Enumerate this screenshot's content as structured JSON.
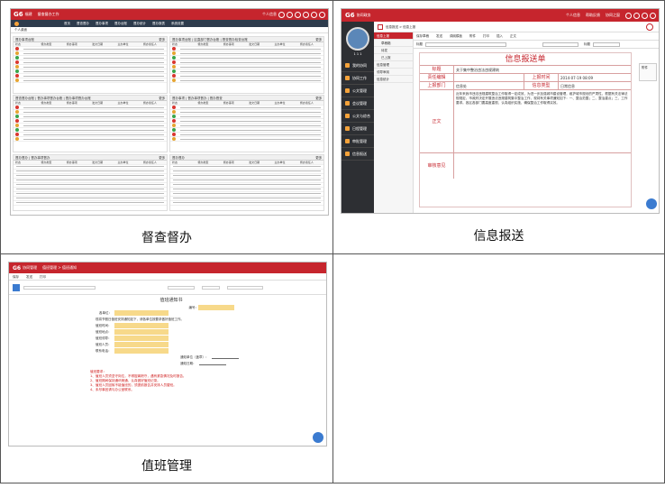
{
  "captions": {
    "supervision": "督查督办",
    "info_report": "信息报送",
    "duty": "值班管理"
  },
  "supervision_app": {
    "logo": "G6",
    "brand": "福建",
    "title": "督查督办工作",
    "user": "个人信息",
    "crumb": "个人桌面",
    "panels": [
      {
        "title": "督办事项台账",
        "more": "更多"
      },
      {
        "title": "督办事项台账 | 区直部门督办台账 | 督查督办检查台账",
        "more": "更多"
      },
      {
        "title": "督查督办台账 | 督办事项督办台账 | 督办事项督办台账",
        "more": "更多"
      },
      {
        "title": "督办事项 | 督办事项督办 | 督办督查",
        "more": "更多"
      },
      {
        "title": "督办督办 | 督办事项督办",
        "more": "更多"
      },
      {
        "title": "督办督办",
        "more": "更多"
      }
    ],
    "cols": [
      "状态",
      "督办类型",
      "督办事项",
      "发文日期",
      "主办单位",
      "督办责任人"
    ],
    "status_colors": [
      "#d9362f",
      "#e6a531",
      "#3aa54a"
    ]
  },
  "info_app": {
    "logo": "G6",
    "brand": "协同政务",
    "crumb": "信息报送 > 信息上报",
    "user_menu": [
      "个人信息",
      "帮助反馈",
      "协同之窗"
    ],
    "sidebar_user": "1 1 1",
    "sidebar": [
      "我的协同",
      "协同工作",
      "公文管理",
      "会议管理",
      "公文与综合",
      "日程管理",
      "审批管理",
      "信息报送"
    ],
    "tree": [
      "信息上报",
      "草稿箱",
      "待发",
      "已上报",
      "信息管理",
      "领导审阅",
      "信息统计"
    ],
    "toolbar": [
      "保存草稿",
      "发送",
      "调阅模板",
      "附件",
      "打印",
      "插入",
      "正文"
    ],
    "subject_label": "标题",
    "form_title": "信息报送单",
    "fields": {
      "title_label": "标题",
      "title_value": "关于集中整治违法违规建筑",
      "org_label": "责任编辑",
      "time_label": "上报时间",
      "time_value": "2014-07-19 08:09",
      "dept_label": "上报部门",
      "dept_value": "信息处",
      "type_label": "信息类型",
      "type_value": "日常信息",
      "body_label": "正文",
      "body_text": "近年来我市违法违规建筑整治工作取得一定成效，为进一步加强城市建设管理，维护城市规划的严肃性，根据有关法律法规规定，市政府决定开展违法违规建筑集中整治工作，现将有关事项通知如下：一、整治范围；二、整治重点；三、工作要求。各区各部门要高度重视，认真组织实施，确保整治工作取得实效。",
      "sign_label": "审核意见"
    },
    "right_labels": [
      "标题",
      "备注"
    ],
    "side_tab": "附件",
    "accent": "#c6252d"
  },
  "duty_app": {
    "logo": "G6",
    "brand": "协同管理",
    "crumb": "值班管理 > 值班通知",
    "toolbar": [
      "保存",
      "发送",
      "打印"
    ],
    "notice_title": "值班通知书",
    "doc_no_label": "编号：",
    "lines": [
      "各单位：",
      "现将节假日值班安排通知如下，请各单位按要求做好值班工作。",
      "值班时间：",
      "值班地点：",
      "值班领导：",
      "值班人员：",
      "联系电话：",
      "通知单位（盖章）：",
      "通知日期："
    ],
    "notes_title": "值班要求：",
    "notes": [
      "1、值班人员须坚守岗位，不得擅离职守，遇有紧急情况及时报告。",
      "2、值班期间保持通讯畅通，认真做好值班记录。",
      "3、值班人员因故不能值班的，须提前报告并安排人员替班。",
      "4、未尽事宜请与办公室联系。"
    ]
  }
}
